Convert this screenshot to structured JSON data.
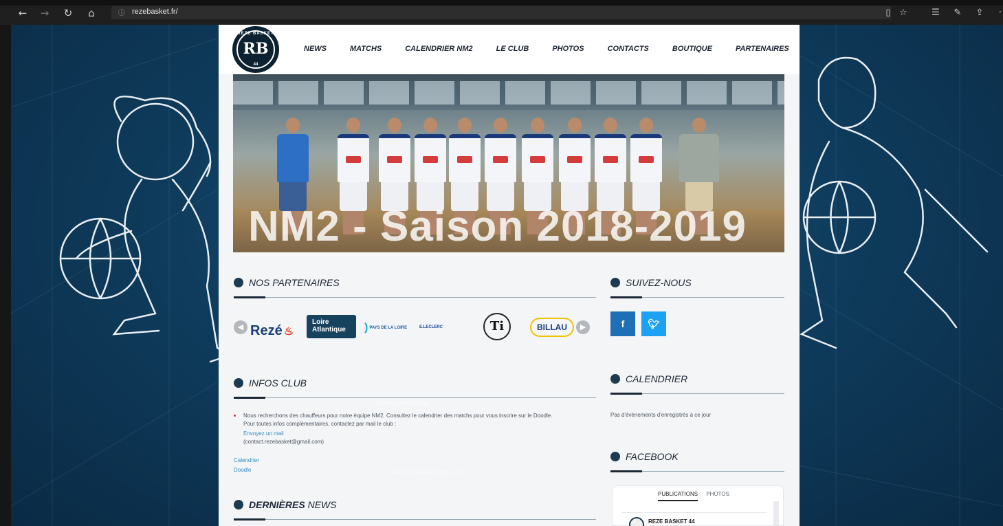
{
  "browser": {
    "url": "rezebasket.fr/",
    "icons": [
      "back-icon",
      "forward-icon",
      "refresh-icon",
      "home-icon",
      "info-icon",
      "reading-view-icon",
      "favorite-star-icon",
      "favorites-list-icon",
      "pen-icon",
      "share-icon",
      "more-icon"
    ]
  },
  "logo": {
    "arc_text": "REZE BASKET",
    "monogram": "RB",
    "number": "44"
  },
  "nav": [
    "NEWS",
    "MATCHS",
    "CALENDRIER NM2",
    "LE CLUB",
    "PHOTOS",
    "CONTACTS",
    "BOUTIQUE",
    "PARTENAIRES"
  ],
  "hero": {
    "title": "NM2 - Saison 2018-2019"
  },
  "partners": {
    "heading": "NOS PARTENAIRES",
    "logos": {
      "reze": "Rezé",
      "loire_line1": "Loire",
      "loire_line2": "Atlantique",
      "pays": "PAYS DE LA LOIRE",
      "leclerc": "E.LECLERC",
      "ti": "Ti",
      "billau": "BILLAU"
    }
  },
  "social": {
    "heading": "SUIVEZ-NOUS",
    "facebook": "f",
    "twitter": "t"
  },
  "infos": {
    "heading": "INFOS CLUB",
    "line1": "Nous recherchons des chauffeurs pour notre équipe NM2. Consultez le calendrier des matchs pour vous inscrire sur le Doodle.",
    "line2": "Pour toutes infos complémentaires, contactez par mail le club :",
    "mail_link": "Envoyez un mail",
    "email": "(contact.rezebasket@gmail.com)",
    "link_calendrier": "Calendrier",
    "link_doodle": "Doodle"
  },
  "ghost_footer": {
    "title": "NOUS CONTACTER",
    "email": "contact.rezebasket@gmail.com"
  },
  "calendar": {
    "heading": "CALENDRIER",
    "empty": "Pas d'évènements d'enregistrés à ce jour"
  },
  "facebook": {
    "heading": "FACEBOOK",
    "tab_publications": "PUBLICATIONS",
    "tab_photos": "PHOTOS",
    "page_name": "REZE BASKET 44"
  },
  "news": {
    "heading_bold": "DERNIÈRES",
    "heading_rest": "NEWS"
  },
  "colors": {
    "page_bg": "#0f3d5e",
    "panel": "#f4f5f6",
    "facebook": "#1e6fb5",
    "twitter": "#1da1f2",
    "link": "#2e8fc8"
  }
}
